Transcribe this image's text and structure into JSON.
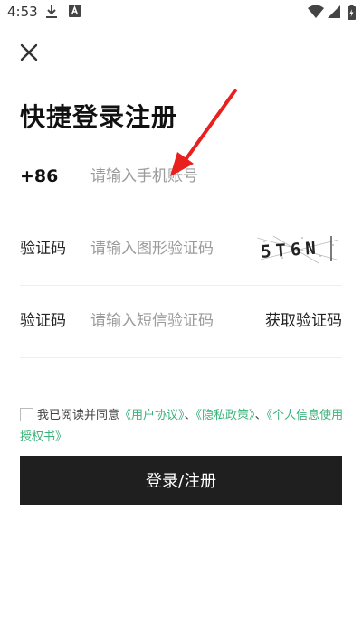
{
  "status_bar": {
    "time": "4:53",
    "icons": [
      "download-icon",
      "a-badge-icon",
      "wifi-icon",
      "signal-icon",
      "battery-icon"
    ]
  },
  "header": {
    "close_icon": "close-icon"
  },
  "title": "快捷登录注册",
  "phone_row": {
    "country_code": "+86",
    "placeholder": "请输入手机账号"
  },
  "captcha_row": {
    "label": "验证码",
    "placeholder": "请输入图形验证码",
    "captcha_text": "5T6N"
  },
  "sms_row": {
    "label": "验证码",
    "placeholder": "请输入短信验证码",
    "get_code": "获取验证码"
  },
  "agreement": {
    "prefix": "我已阅读并同意",
    "link1": "《用户协议》",
    "sep1": "、",
    "link2": "《隐私政策》",
    "sep2": "、",
    "link3": "《个人信息使用授权书》"
  },
  "login_button": "登录/注册",
  "colors": {
    "accent_link": "#3bb27a",
    "button_bg": "#1f1f1f",
    "arrow": "#e8201e"
  }
}
